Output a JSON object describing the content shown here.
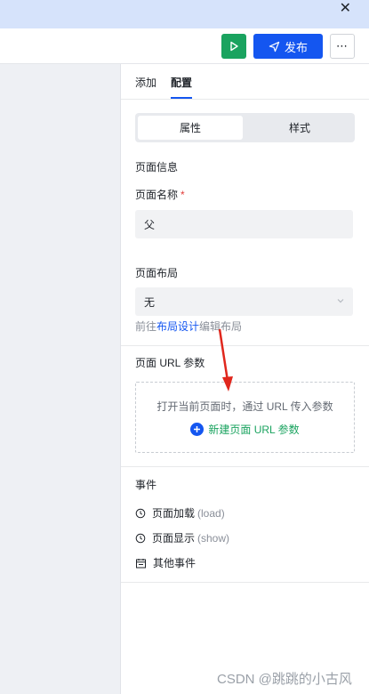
{
  "titlebar": {
    "close_glyph": "✕"
  },
  "toolbar": {
    "run_icon": "play-icon",
    "publish_label": "发布",
    "publish_icon": "send-icon",
    "more_glyph": "⋯"
  },
  "panel": {
    "tabs": [
      {
        "label": "添加",
        "active": false
      },
      {
        "label": "配置",
        "active": true
      }
    ],
    "segment": [
      {
        "label": "属性",
        "selected": true
      },
      {
        "label": "样式",
        "selected": false
      }
    ],
    "page_info": {
      "section_title": "页面信息",
      "name_label": "页面名称",
      "required_mark": "*",
      "name_value": "父"
    },
    "layout": {
      "label": "页面布局",
      "selected": "无",
      "hint_prefix": "前往",
      "hint_link": "布局设计",
      "hint_suffix": "编辑布局"
    },
    "url_params": {
      "title": "页面 URL 参数",
      "description": "打开当前页面时，通过 URL 传入参数",
      "add_label": "新建页面 URL 参数"
    },
    "events": {
      "title": "事件",
      "items": [
        {
          "label": "页面加载",
          "sub": "(load)",
          "icon": "clock-icon"
        },
        {
          "label": "页面显示",
          "sub": "(show)",
          "icon": "clock-icon"
        },
        {
          "label": "其他事件",
          "sub": "",
          "icon": "calendar-icon"
        }
      ]
    }
  },
  "watermark": "CSDN @跳跳的小古风",
  "colors": {
    "accent": "#1456f0",
    "success": "#1aa35f",
    "required": "#e23c39"
  }
}
